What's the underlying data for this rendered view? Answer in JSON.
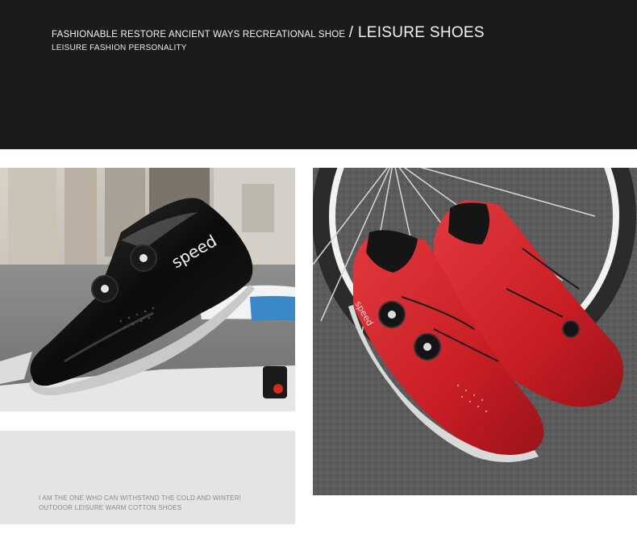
{
  "banner": {
    "line1_small": "FASHIONABLE RESTORE ANCIENT WAYS RECREATIONAL SHOE",
    "line1_big": "/ LEISURE SHOES",
    "line2": "LEISURE FASHION PERSONALITY"
  },
  "left_photo": {
    "shoe_brand": "speed",
    "shoe_color": "#0a0a0a"
  },
  "right_photo": {
    "shoe_brand": "speed",
    "shoe_color": "#c81e24"
  },
  "caption": {
    "line1": "I AM THE ONE WHO CAN WITHSTAND THE COLD AND WINTER!",
    "line2": "OUTDOOR LEISURE WARM COTTON SHOES"
  },
  "colors": {
    "banner_bg": "#1b1b1b",
    "caption_bg": "#e4e4e4"
  }
}
